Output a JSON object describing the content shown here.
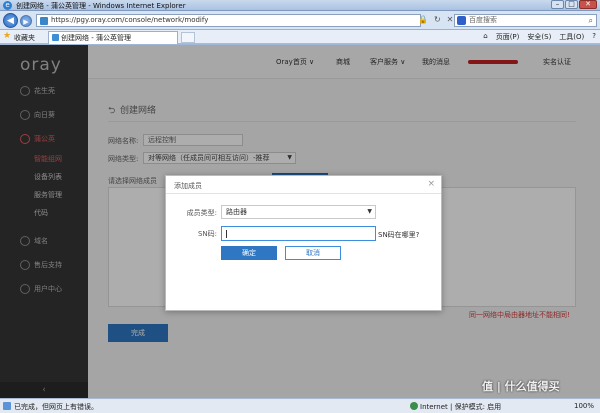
{
  "window": {
    "title": "创建网络 - 蒲公英管理 - Windows Internet Explorer"
  },
  "address": {
    "url": "https://pgy.oray.com/console/network/modify",
    "search_placeholder": "百度搜索"
  },
  "favorites": {
    "label": "收藏夹",
    "tab_title": "创建网络 - 蒲公英管理",
    "commands": [
      "页面(P)",
      "安全(S)",
      "工具(O)"
    ]
  },
  "sidebar": {
    "logo": "oray",
    "items": [
      {
        "label": "花生壳"
      },
      {
        "label": "向日葵"
      },
      {
        "label": "蒲公英"
      }
    ],
    "sub_items": [
      {
        "label": "智能组网"
      },
      {
        "label": "设备列表"
      },
      {
        "label": "服务管理"
      },
      {
        "label": "代码"
      }
    ],
    "items_bottom": [
      {
        "label": "域名"
      },
      {
        "label": "售后支持"
      },
      {
        "label": "用户中心"
      }
    ],
    "collapse": "‹"
  },
  "topnav": {
    "home": "Oray首页 ∨",
    "mall": "商城",
    "service": "客户服务 ∨",
    "messages": "我的消息",
    "verify": "实名认证"
  },
  "form": {
    "title": "创建网络",
    "name_label": "网络名称:",
    "name_value": "远程控制",
    "type_label": "网络类型:",
    "type_value": "对等网络（任成员间可相互访问）-推荐",
    "member_label": "请选择网络成员",
    "warning": "同一网络中局由器地址不能相同!",
    "done": "完成"
  },
  "modal": {
    "title": "添加成员",
    "member_type_label": "成员类型:",
    "member_type_value": "路由器",
    "sn_label": "SN码:",
    "sn_value": "",
    "sn_help": "SN码在哪里?",
    "confirm": "确定",
    "cancel": "取消"
  },
  "status": {
    "text": "已完成，但网页上有错误。",
    "zone": "Internet | 保护模式: 启用",
    "zoom": "100%"
  },
  "watermark": "值 | 什么值得买"
}
